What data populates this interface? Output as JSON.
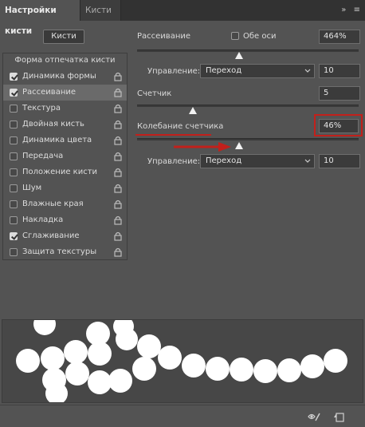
{
  "tabs": {
    "active": "Настройки кисти",
    "inactive": "Кисти"
  },
  "tabbar_icons": {
    "collapse": "collapse-arrows-icon",
    "menu": "panel-menu-icon",
    "collapse_glyph": "»",
    "menu_glyph": "≡"
  },
  "brushes_button": "Кисти",
  "brush_list": {
    "header": "Форма отпечатка кисти",
    "items": [
      {
        "label": "Динамика формы",
        "checked": true,
        "locked": true
      },
      {
        "label": "Рассеивание",
        "checked": true,
        "locked": true,
        "selected": true
      },
      {
        "label": "Текстура",
        "checked": false,
        "locked": true
      },
      {
        "label": "Двойная кисть",
        "checked": false,
        "locked": true
      },
      {
        "label": "Динамика цвета",
        "checked": false,
        "locked": true
      },
      {
        "label": "Передача",
        "checked": false,
        "locked": true
      },
      {
        "label": "Положение кисти",
        "checked": false,
        "locked": true
      },
      {
        "label": "Шум",
        "checked": false,
        "locked": true
      },
      {
        "label": "Влажные края",
        "checked": false,
        "locked": true
      },
      {
        "label": "Накладка",
        "checked": false,
        "locked": true
      },
      {
        "label": "Сглаживание",
        "checked": true,
        "locked": true
      },
      {
        "label": "Защита текстуры",
        "checked": false,
        "locked": true
      }
    ]
  },
  "scatter": {
    "label": "Рассеивание",
    "both_axes_label": "Обе оси",
    "both_axes_checked": false,
    "value": "464%",
    "slider_fraction": 0.46,
    "control_label": "Управление:",
    "control_value": "Переход",
    "control_number": "10"
  },
  "count": {
    "label": "Счетчик",
    "value": "5",
    "slider_fraction": 0.25
  },
  "count_jitter": {
    "label": "Колебание счетчика",
    "value": "46%",
    "slider_fraction": 0.46,
    "control_label": "Управление:",
    "control_value": "Переход",
    "control_number": "10"
  },
  "annotation_color": "#c2201b",
  "bottom_icons": {
    "left": "eye-brush-icon",
    "right": "new-preset-icon"
  }
}
